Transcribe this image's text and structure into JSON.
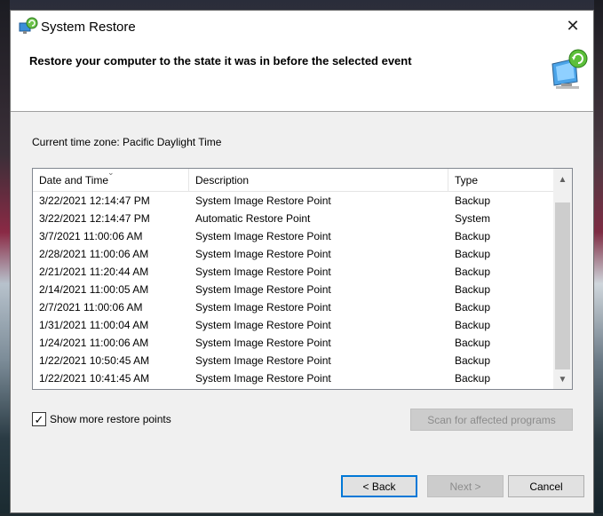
{
  "window": {
    "title": "System Restore",
    "close_glyph": "✕"
  },
  "header": {
    "title": "Restore your computer to the state it was in before the selected event"
  },
  "timezone_text": "Current time zone: Pacific Daylight Time",
  "list": {
    "columns": [
      "Date and Time",
      "Description",
      "Type"
    ],
    "sort_glyph": "⌄",
    "rows": [
      [
        "3/22/2021 12:14:47 PM",
        "System Image Restore Point",
        "Backup"
      ],
      [
        "3/22/2021 12:14:47 PM",
        "Automatic Restore Point",
        "System"
      ],
      [
        "3/7/2021 11:00:06 AM",
        "System Image Restore Point",
        "Backup"
      ],
      [
        "2/28/2021 11:00:06 AM",
        "System Image Restore Point",
        "Backup"
      ],
      [
        "2/21/2021 11:20:44 AM",
        "System Image Restore Point",
        "Backup"
      ],
      [
        "2/14/2021 11:00:05 AM",
        "System Image Restore Point",
        "Backup"
      ],
      [
        "2/7/2021 11:00:06 AM",
        "System Image Restore Point",
        "Backup"
      ],
      [
        "1/31/2021 11:00:04 AM",
        "System Image Restore Point",
        "Backup"
      ],
      [
        "1/24/2021 11:00:06 AM",
        "System Image Restore Point",
        "Backup"
      ],
      [
        "1/22/2021 10:50:45 AM",
        "System Image Restore Point",
        "Backup"
      ],
      [
        "1/22/2021 10:41:45 AM",
        "System Image Restore Point",
        "Backup"
      ]
    ],
    "scroll_up_glyph": "▲",
    "scroll_down_glyph": "▼"
  },
  "show_more": {
    "label": "Show more restore points",
    "checked": true,
    "check_glyph": "✓"
  },
  "buttons": {
    "scan": "Scan for affected programs",
    "back": "< Back",
    "next": "Next >",
    "cancel": "Cancel"
  },
  "colors": {
    "focus_accent": "#0078d7",
    "disabled_text": "#8c8c8c"
  }
}
